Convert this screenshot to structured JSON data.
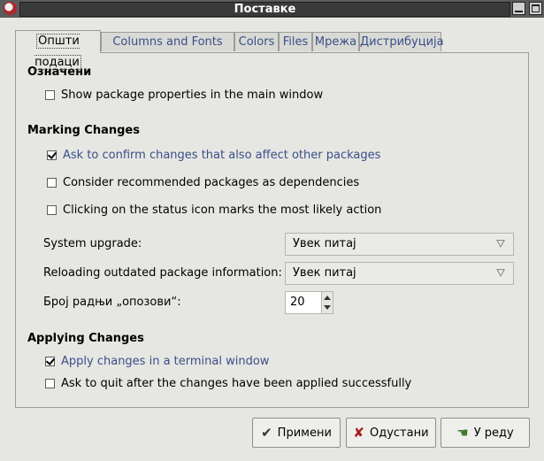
{
  "window": {
    "title": "Поставке"
  },
  "tabs": [
    {
      "label": "Општи подаци",
      "active": true
    },
    {
      "label": "Columns and Fonts"
    },
    {
      "label": "Colors"
    },
    {
      "label": "Files"
    },
    {
      "label": "Мрежа"
    },
    {
      "label": "Дистрибуција"
    }
  ],
  "sections": {
    "general": {
      "title": "Означени",
      "show_props": {
        "label": "Show package properties in the main window",
        "checked": false
      }
    },
    "marking": {
      "title": "Marking Changes",
      "ask_confirm": {
        "label": "Ask to confirm changes that also affect other packages",
        "checked": true
      },
      "recommended": {
        "label": "Consider recommended packages as dependencies",
        "checked": false
      },
      "status_icon": {
        "label": "Clicking on the status icon marks the most likely action",
        "checked": false
      },
      "system_upgrade": {
        "label": "System upgrade:",
        "value": "Увек питај"
      },
      "reloading": {
        "label": "Reloading outdated package information:",
        "value": "Увек питај"
      },
      "undo": {
        "label": "Број радњи „опозови“:",
        "value": "20"
      }
    },
    "applying": {
      "title": "Applying Changes",
      "terminal": {
        "label": "Apply changes in a terminal window",
        "checked": true
      },
      "quit": {
        "label": "Ask to quit after the changes have been applied successfully",
        "checked": false
      }
    }
  },
  "buttons": {
    "apply": "Примени",
    "cancel": "Одустани",
    "ok": "У реду"
  }
}
